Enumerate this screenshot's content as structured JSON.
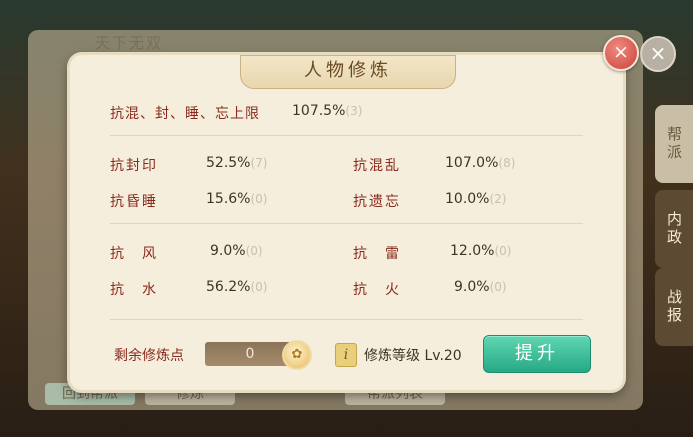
{
  "background": {
    "title": "天下无双",
    "side_tabs": [
      "帮派",
      "内政",
      "战报"
    ],
    "bottom_buttons": [
      "回到帮派",
      "修炼",
      "帮派列表"
    ]
  },
  "dialog": {
    "title": "人物修炼",
    "close_icon": "×",
    "limit_row": {
      "label": "抗混、封、睡、忘上限",
      "value": "107.5%",
      "level": "(3)"
    },
    "stats": [
      {
        "label": "抗封印",
        "value": "52.5%",
        "level": "(7)"
      },
      {
        "label": "抗混乱",
        "value": "107.0%",
        "level": "(8)"
      },
      {
        "label": "抗昏睡",
        "value": "15.6%",
        "level": "(0)"
      },
      {
        "label": "抗遗忘",
        "value": "10.0%",
        "level": "(2)"
      },
      {
        "label": "抗　风",
        "value": "9.0%",
        "level": "(0)"
      },
      {
        "label": "抗　雷",
        "value": "12.0%",
        "level": "(0)"
      },
      {
        "label": "抗　水",
        "value": "56.2%",
        "level": "(0)"
      },
      {
        "label": "抗　火",
        "value": "9.0%",
        "level": "(0)"
      }
    ],
    "points_label": "剩余修炼点",
    "points_value": "0",
    "info_icon": "i",
    "level_label": "修炼等级 Lv.20",
    "upgrade_label": "提升"
  },
  "colors": {
    "accent_label": "#8a2a1c",
    "button_green": "#27a985",
    "close_red": "#c9433a"
  }
}
